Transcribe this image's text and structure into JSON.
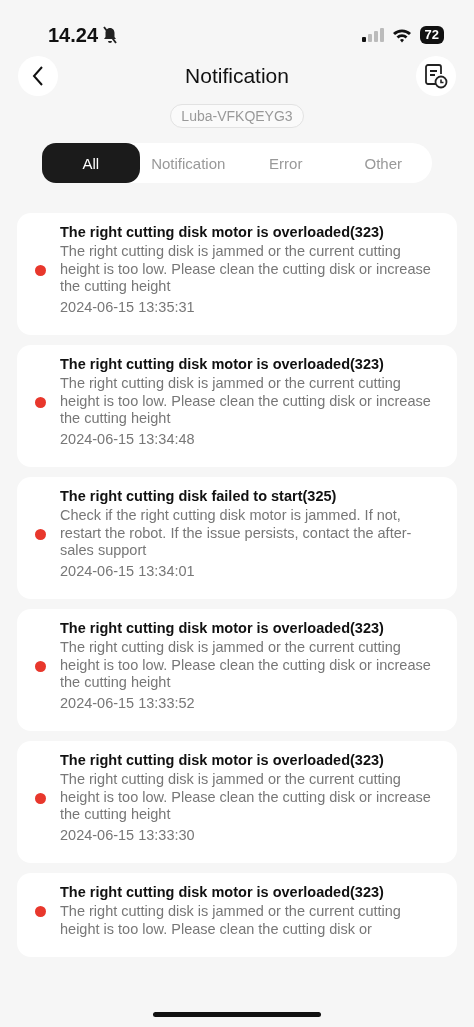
{
  "status_bar": {
    "time": "14.24",
    "battery": "72"
  },
  "header": {
    "title": "Notification",
    "device": "Luba-VFKQEYG3"
  },
  "tabs": [
    {
      "label": "All",
      "selected": true
    },
    {
      "label": "Notification",
      "selected": false
    },
    {
      "label": "Error",
      "selected": false
    },
    {
      "label": "Other",
      "selected": false
    }
  ],
  "notifications": [
    {
      "title": "The right cutting disk motor is overloaded(323)",
      "message": "The right cutting disk is jammed or the current cutting height is too low. Please clean the cutting disk or increase the cutting height",
      "time": "2024-06-15 13:35:31",
      "unread": true
    },
    {
      "title": "The right cutting disk motor is overloaded(323)",
      "message": "The right cutting disk is jammed or the current cutting height is too low. Please clean the cutting disk or increase the cutting height",
      "time": "2024-06-15 13:34:48",
      "unread": true
    },
    {
      "title": "The right cutting disk failed to start(325)",
      "message": "Check if the right cutting disk motor is jammed. If not, restart the robot. If the issue persists, contact the after-sales support",
      "time": "2024-06-15 13:34:01",
      "unread": true
    },
    {
      "title": "The right cutting disk motor is overloaded(323)",
      "message": "The right cutting disk is jammed or the current cutting height is too low. Please clean the cutting disk or increase the cutting height",
      "time": "2024-06-15 13:33:52",
      "unread": true
    },
    {
      "title": "The right cutting disk motor is overloaded(323)",
      "message": "The right cutting disk is jammed or the current cutting height is too low. Please clean the cutting disk or increase the cutting height",
      "time": "2024-06-15 13:33:30",
      "unread": true
    },
    {
      "title": "The right cutting disk motor is overloaded(323)",
      "message": "The right cutting disk is jammed or the current cutting height is too low. Please clean the cutting disk or",
      "unread": true
    }
  ]
}
